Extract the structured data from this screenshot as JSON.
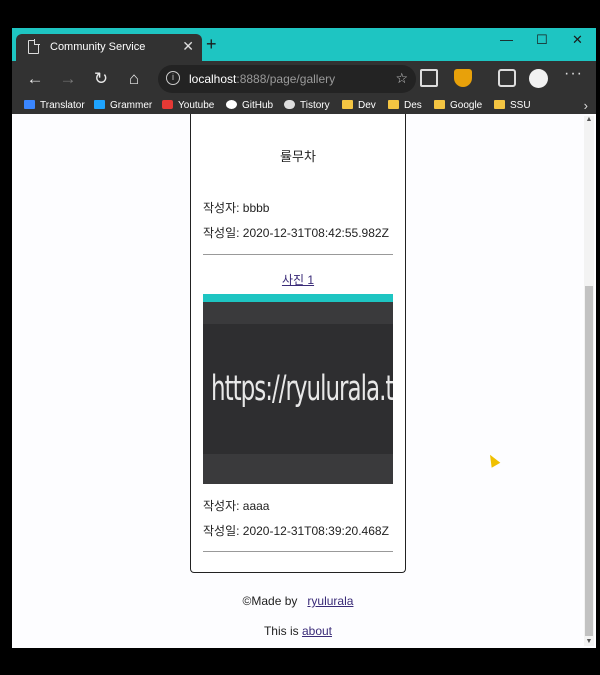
{
  "browser": {
    "tab_title": "Community Service",
    "tab_close": "✕",
    "new_tab": "+",
    "window_controls": [
      "—",
      "☐",
      "✕"
    ],
    "url_host": "localhost",
    "url_rest": ":8888/page/gallery",
    "bookmarks": [
      {
        "label": "Translator",
        "icon": "translator-icon"
      },
      {
        "label": "Grammer",
        "icon": "grammarly-icon"
      },
      {
        "label": "Youtube",
        "icon": "youtube-icon"
      },
      {
        "label": "GitHub",
        "icon": "github-icon"
      },
      {
        "label": "Tistory",
        "icon": "cloud-icon"
      },
      {
        "label": "Dev",
        "icon": "folder-icon"
      },
      {
        "label": "Des",
        "icon": "folder-icon"
      },
      {
        "label": "Google",
        "icon": "folder-icon"
      },
      {
        "label": "SSU",
        "icon": "folder-icon"
      }
    ],
    "accent_color": "#1ec5c2"
  },
  "gallery": {
    "post1": {
      "name": "률무차",
      "author": "작성자: bbbb",
      "date": "작성일: 2020-12-31T08:42:55.982Z"
    },
    "post2": {
      "photo_link": "사진 1",
      "photo_text": "https://ryulurala.tistory.com",
      "author": "작성자: aaaa",
      "date": "작성일: 2020-12-31T08:39:20.468Z"
    }
  },
  "footer": {
    "made_by": "©Made by",
    "made_by_link": "ryulurala",
    "this_is": "This is",
    "about_link": "about"
  }
}
